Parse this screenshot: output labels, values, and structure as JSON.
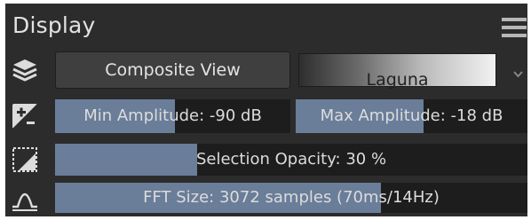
{
  "panel": {
    "title": "Display"
  },
  "icons": {
    "menu": "hamburger-menu-icon",
    "layers": "layers-icon",
    "amplitude": "plus-minus-icon",
    "selection": "selection-opacity-icon",
    "fft": "fft-waveform-icon",
    "dropdown": "chevron-down-icon"
  },
  "view": {
    "mode_button_label": "Composite View",
    "colormap_label": "Laguna"
  },
  "amplitude": {
    "min_label": "Min Amplitude: -90 dB",
    "min_value_db": -90,
    "min_fill_fraction": 0.51,
    "max_label": "Max Amplitude: -18 dB",
    "max_value_db": -18,
    "max_fill_fraction": 0.55
  },
  "selection": {
    "label": "Selection Opacity: 30 %",
    "value_percent": 30
  },
  "fft": {
    "label": "FFT Size: 3072 samples (70ms/14Hz)",
    "fill_fraction": 0.69
  },
  "colors": {
    "panel_bg": "#2c2c2c",
    "slider_bg": "#1d1d1d",
    "slider_fill": "#6a7d99",
    "text": "#dcdcdc",
    "button_bg": "#3f3f3f"
  }
}
